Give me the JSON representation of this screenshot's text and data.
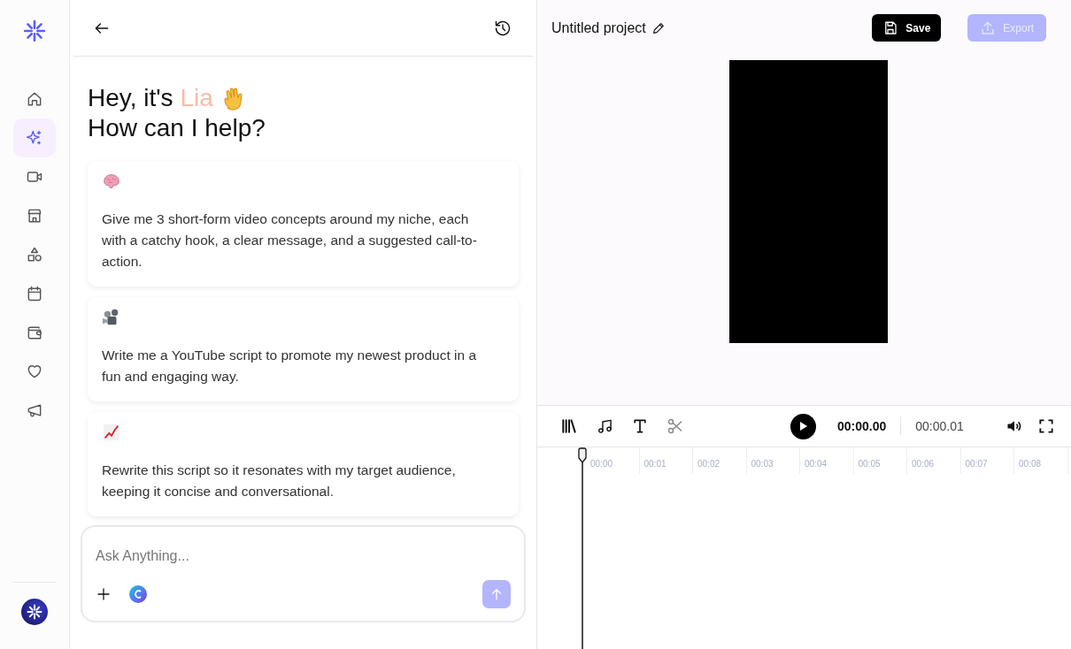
{
  "sidebar": {
    "items": [
      {
        "kind": "home",
        "selected": false
      },
      {
        "kind": "sparkle",
        "selected": true
      },
      {
        "kind": "video",
        "selected": false
      },
      {
        "kind": "store",
        "selected": false
      },
      {
        "kind": "shapes",
        "selected": false
      },
      {
        "kind": "calendar",
        "selected": false
      },
      {
        "kind": "wallet",
        "selected": false
      },
      {
        "kind": "heart",
        "selected": false
      },
      {
        "kind": "megaphone",
        "selected": false
      }
    ]
  },
  "chat": {
    "greeting": {
      "prefix": "Hey, it's",
      "name": "Lia",
      "line2": "How can I help?"
    },
    "prompts": [
      {
        "kind": "brain",
        "text": "Give me 3 short-form video concepts around my niche, each with a catchy hook, a clear message, and a suggested call-to-action."
      },
      {
        "kind": "projector",
        "text": "Write me a YouTube script to promote my newest product in a fun and engaging way."
      },
      {
        "kind": "chart",
        "text": "Rewrite this script so it resonates with my target audience, keeping it concise and conversational."
      }
    ],
    "input": {
      "placeholder": "Ask Anything..."
    }
  },
  "editor": {
    "project_title": "Untitled project",
    "save": {
      "label": "Save",
      "disabled": false
    },
    "export": {
      "label": "Export",
      "disabled": true
    },
    "timeline": {
      "tools": [
        {
          "kind": "library"
        },
        {
          "kind": "music"
        },
        {
          "kind": "text"
        },
        {
          "kind": "scissors"
        }
      ],
      "current_time": "00:00.00",
      "total_time": "00:00.01",
      "ruler": [
        "00:00",
        "00:01",
        "00:02",
        "00:03",
        "00:04",
        "00:05",
        "00:06",
        "00:07",
        "00:08"
      ]
    }
  }
}
